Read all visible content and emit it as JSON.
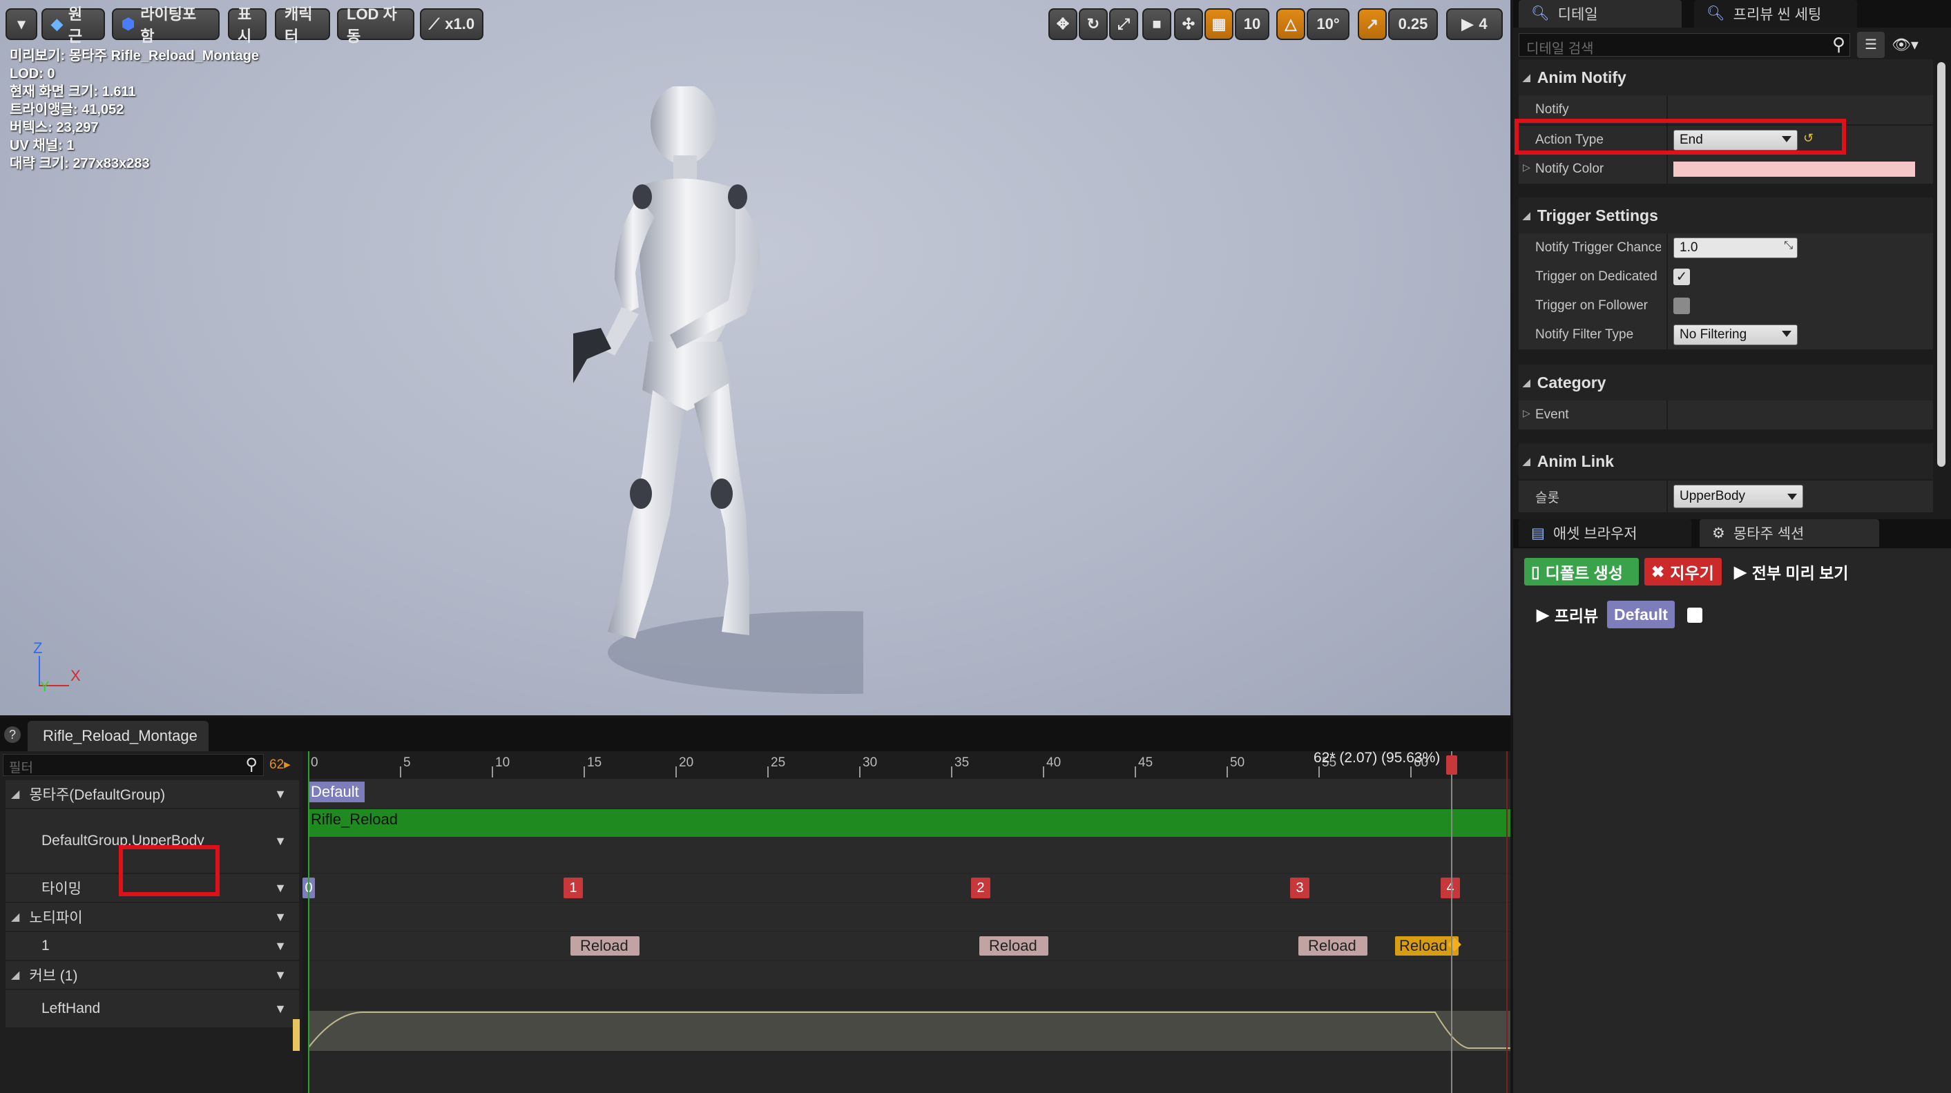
{
  "viewport": {
    "toolbar": {
      "menu_icon": "chevron-down-icon",
      "perspective": "원근",
      "lighting": "라이팅포함",
      "show": "표시",
      "character": "캐릭터",
      "lod": "LOD 자동",
      "speed": "x1.0",
      "grid_snap": "10",
      "rotate_snap": "10°",
      "scale_snap": "0.25",
      "camera_speed": "4"
    },
    "stats": {
      "line1": "미리보기: 몽타주 Rifle_Reload_Montage",
      "line2": "LOD: 0",
      "line3": "현재 화면 크기: 1.611",
      "line4": "트라이앵글: 41,052",
      "line5": "버텍스: 23,297",
      "line6": "UV 채널: 1",
      "line7": "대략 크기: 277x83x283"
    },
    "axes": {
      "z": "Z",
      "y": "Y",
      "x": "X"
    }
  },
  "timeline": {
    "tab_label": "Rifle_Reload_Montage",
    "filter_placeholder": "필터",
    "frame_count": "62",
    "current_frame": "62* (2.07) (95.63%)",
    "ticks": [
      "0",
      "5",
      "10",
      "15",
      "20",
      "25",
      "30",
      "35",
      "40",
      "45",
      "50",
      "55",
      "60"
    ],
    "rows": {
      "montage": "몽타주(DefaultGroup)",
      "slot": "DefaultGroup.UpperBody",
      "timing": "타이밍",
      "notifies": "노티파이",
      "notify_track": "1",
      "curves": "커브  (1)",
      "curve_track": "LeftHand"
    },
    "section_label": "Default",
    "segment_label": "Rifle_Reload",
    "timing_markers": [
      "0",
      "1",
      "2",
      "3",
      "4"
    ],
    "notifies": [
      "Reload",
      "Reload",
      "Reload",
      "Reload"
    ]
  },
  "details": {
    "tabs": {
      "details": "디테일",
      "preview": "프리뷰 씬 세팅"
    },
    "search_placeholder": "디테일 검색",
    "categories": {
      "anim_notify": "Anim Notify",
      "trigger": "Trigger Settings",
      "category": "Category",
      "anim_link": "Anim Link"
    },
    "props": {
      "notify": "Notify",
      "action_type": "Action Type",
      "action_type_value": "End",
      "notify_color": "Notify Color",
      "trigger_chance": "Notify Trigger Chance",
      "trigger_chance_value": "1.0",
      "trigger_dedicated": "Trigger on Dedicated",
      "trigger_follower": "Trigger on Follower",
      "filter_type": "Notify Filter Type",
      "filter_type_value": "No Filtering",
      "event": "Event",
      "slot": "슬롯",
      "slot_value": "UpperBody"
    },
    "colors": {
      "notify_color": "#f6c7c7",
      "accent_red": "#e0101a"
    }
  },
  "sections_panel": {
    "tabs": {
      "asset_browser": "애셋 브라우저",
      "montage_sections": "몽타주 섹션"
    },
    "create_default": "디폴트 생성",
    "clear": "지우기",
    "preview_all": "전부 미리 보기",
    "preview": "프리뷰",
    "default_section": "Default"
  }
}
